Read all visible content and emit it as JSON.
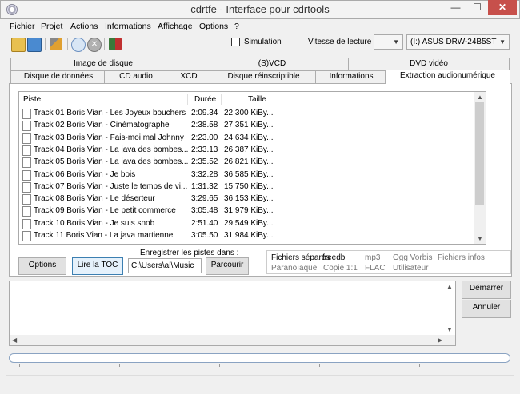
{
  "window": {
    "title": "cdrtfe - Interface pour cdrtools",
    "min": "—",
    "max": "☐",
    "close": "✕"
  },
  "menu": [
    "Fichier",
    "Projet",
    "Actions",
    "Informations",
    "Affichage",
    "Options",
    "?"
  ],
  "toolbar": {
    "icons": [
      "open-project-icon",
      "copy-icon",
      "settings-icon",
      "refresh-icon",
      "cancel-icon",
      "exit-icon"
    ],
    "simulation_label": "Simulation",
    "simulation_checked": false,
    "speed_label": "Vitesse de lecture :",
    "speed_value": "",
    "drive_value": "(I:) ASUS DRW-24B5ST"
  },
  "tabs_row1": [
    "Image de disque",
    "(S)VCD",
    "DVD vidéo"
  ],
  "tabs_row2": [
    "Disque de données",
    "CD audio",
    "XCD",
    "Disque réinscriptible",
    "Informations",
    "Extraction audionumérique"
  ],
  "active_tab": "Extraction audionumérique",
  "list": {
    "headers": {
      "track": "Piste",
      "duration": "Durée",
      "size": "Taille"
    },
    "rows": [
      {
        "name": "Track 01  Boris Vian - Les Joyeux bouchers",
        "duration": "2:09.34",
        "size": "22 300 KiBy..."
      },
      {
        "name": "Track 02  Boris Vian - Cinématographe",
        "duration": "2:38.58",
        "size": "27 351 KiBy..."
      },
      {
        "name": "Track 03  Boris Vian - Fais-moi mal Johnny",
        "duration": "2:23.00",
        "size": "24 634 KiBy..."
      },
      {
        "name": "Track 04  Boris Vian - La java des bombes...",
        "duration": "2:33.13",
        "size": "26 387 KiBy..."
      },
      {
        "name": "Track 05  Boris Vian - La java des bombes...",
        "duration": "2:35.52",
        "size": "26 821 KiBy..."
      },
      {
        "name": "Track 06  Boris Vian - Je bois",
        "duration": "3:32.28",
        "size": "36 585 KiBy..."
      },
      {
        "name": "Track 07  Boris Vian - Juste le temps de vi...",
        "duration": "1:31.32",
        "size": "15 750 KiBy..."
      },
      {
        "name": "Track 08  Boris Vian - Le déserteur",
        "duration": "3:29.65",
        "size": "36 153 KiBy..."
      },
      {
        "name": "Track 09  Boris Vian - Le petit commerce",
        "duration": "3:05.48",
        "size": "31 979 KiBy..."
      },
      {
        "name": "Track 10  Boris Vian - Je suis snob",
        "duration": "2:51.40",
        "size": "29 549 KiBy..."
      },
      {
        "name": "Track 11  Boris Vian - La java martienne",
        "duration": "3:05.50",
        "size": "31 984 KiBy..."
      }
    ]
  },
  "buttons": {
    "options": "Options",
    "read_toc": "Lire la TOC",
    "browse": "Parcourir",
    "start": "Démarrer",
    "cancel": "Annuler"
  },
  "save": {
    "label": "Enregistrer les pistes dans :",
    "path": "C:\\Users\\al\\Music"
  },
  "options_panel": {
    "row1": [
      "Fichiers séparés",
      "freedb",
      "mp3",
      "Ogg Vorbis",
      "Fichiers infos"
    ],
    "row2": [
      "Paranoïaque",
      "Copie 1:1",
      "FLAC",
      "Utilisateur"
    ]
  },
  "colors": {
    "accent": "#3c7fb1",
    "close_button": "#c7504b"
  }
}
